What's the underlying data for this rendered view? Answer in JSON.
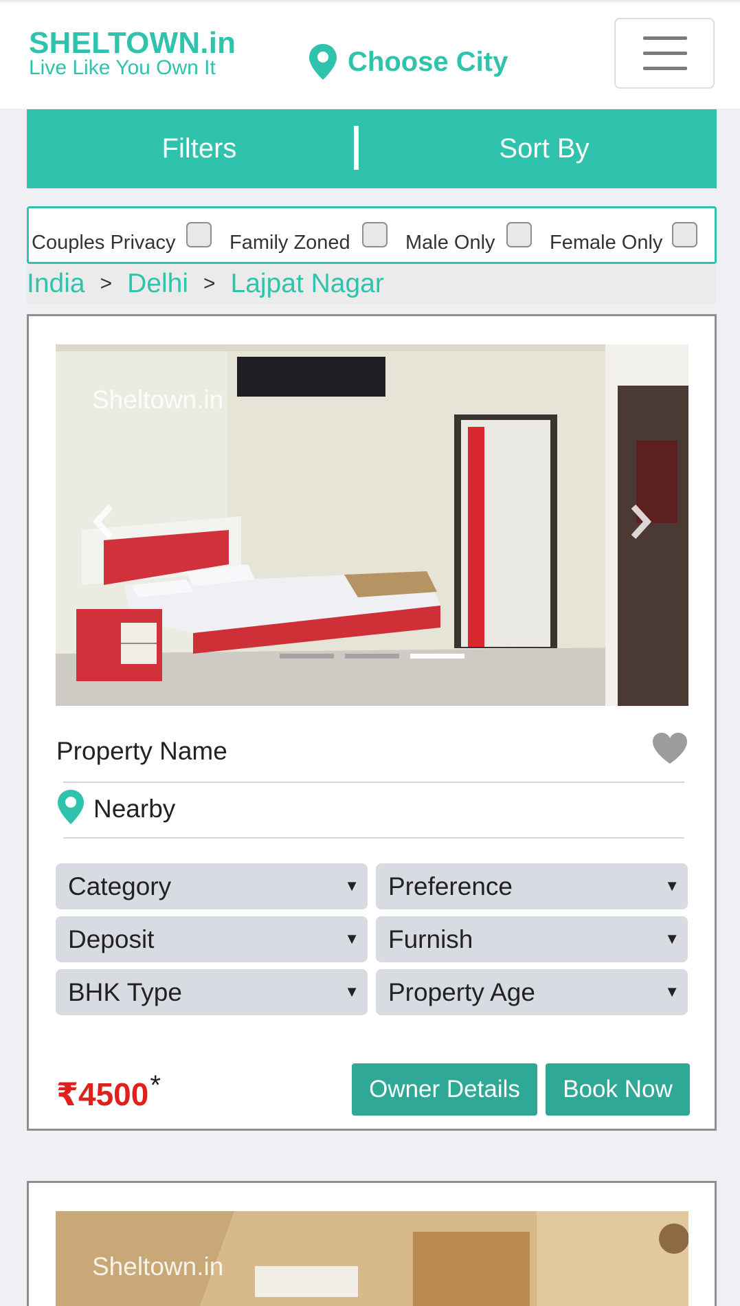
{
  "header": {
    "brand_name": "SHELTOWN.in",
    "brand_tagline": "Live Like You Own It",
    "city_label": "Choose City"
  },
  "filter_bar": {
    "filters_label": "Filters",
    "sort_label": "Sort By"
  },
  "checkboxes": [
    {
      "label": "Couples Privacy",
      "checked": false
    },
    {
      "label": "Family Zoned",
      "checked": false
    },
    {
      "label": "Male Only",
      "checked": false
    },
    {
      "label": "Female Only",
      "checked": false
    }
  ],
  "breadcrumb": [
    "India",
    "Delhi",
    "Lajpat Nagar"
  ],
  "breadcrumb_separator": ">",
  "listings": [
    {
      "watermark": "Sheltown.in",
      "slides_total": 3,
      "active_slide": 3,
      "property_name": "Property Name",
      "nearby": "Nearby",
      "selects": {
        "category": "Category",
        "preference": "Preference",
        "deposit": "Deposit",
        "furnish": "Furnish",
        "bhk_type": "BHK Type",
        "property_age": "Property Age"
      },
      "price": "₹4500",
      "price_mark": "*",
      "owner_details_label": "Owner Details",
      "book_now_label": "Book Now"
    },
    {
      "watermark": "Sheltown.in"
    }
  ],
  "colors": {
    "accent": "#2fc2ac",
    "button": "#2fa996",
    "price": "#e0201b",
    "background": "#eff0f4"
  },
  "icons": [
    "map-pin-icon",
    "hamburger-menu-icon",
    "chevron-left-icon",
    "chevron-right-icon",
    "heart-icon",
    "caret-down-icon"
  ]
}
